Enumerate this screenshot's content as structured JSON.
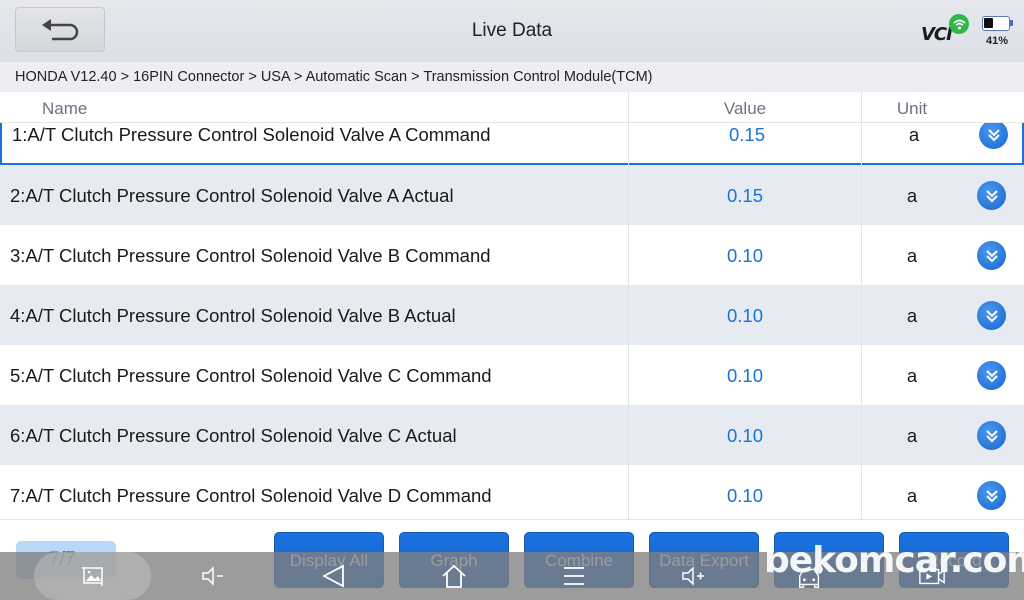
{
  "header": {
    "title": "Live Data",
    "vci_label": "VCI",
    "battery_percent_text": "41%",
    "battery_level": 0.41
  },
  "breadcrumb": {
    "text": "HONDA V12.40 > 16PIN Connector  > USA  > Automatic Scan  > Transmission Control Module(TCM)"
  },
  "table": {
    "columns": {
      "name": "Name",
      "value": "Value",
      "unit": "Unit"
    },
    "rows": [
      {
        "name": "1:A/T Clutch Pressure Control Solenoid Valve A Command",
        "value": "0.15",
        "unit": "a"
      },
      {
        "name": "2:A/T Clutch Pressure Control Solenoid Valve A Actual",
        "value": "0.15",
        "unit": "a"
      },
      {
        "name": "3:A/T Clutch Pressure Control Solenoid Valve B Command",
        "value": "0.10",
        "unit": "a"
      },
      {
        "name": "4:A/T Clutch Pressure Control Solenoid Valve B Actual",
        "value": "0.10",
        "unit": "a"
      },
      {
        "name": "5:A/T Clutch Pressure Control Solenoid Valve C Command",
        "value": "0.10",
        "unit": "a"
      },
      {
        "name": "6:A/T Clutch Pressure Control Solenoid Valve C Actual",
        "value": "0.10",
        "unit": "a"
      },
      {
        "name": "7:A/T Clutch Pressure Control Solenoid Valve D Command",
        "value": "0.10",
        "unit": "a"
      }
    ]
  },
  "footer": {
    "page_current": "7",
    "page_separator": "/",
    "page_total": "7",
    "buttons": [
      {
        "label": "Display All"
      },
      {
        "label": "Graph"
      },
      {
        "label": "Combine"
      },
      {
        "label": "Data Export"
      },
      {
        "label": ""
      },
      {
        "label": "Record"
      }
    ]
  },
  "system_nav": {
    "icons": [
      "screenshot-icon",
      "volume-down-icon",
      "back-icon",
      "home-icon",
      "recents-icon",
      "volume-up-icon",
      "vehicle-icon",
      "screen-record-icon"
    ]
  },
  "watermark": "bekomcar.com",
  "colors": {
    "accent": "#1a73d9",
    "row_alt": "#e6eaf1",
    "wifi_badge": "#2fb84a",
    "button": "#1a72e0"
  }
}
